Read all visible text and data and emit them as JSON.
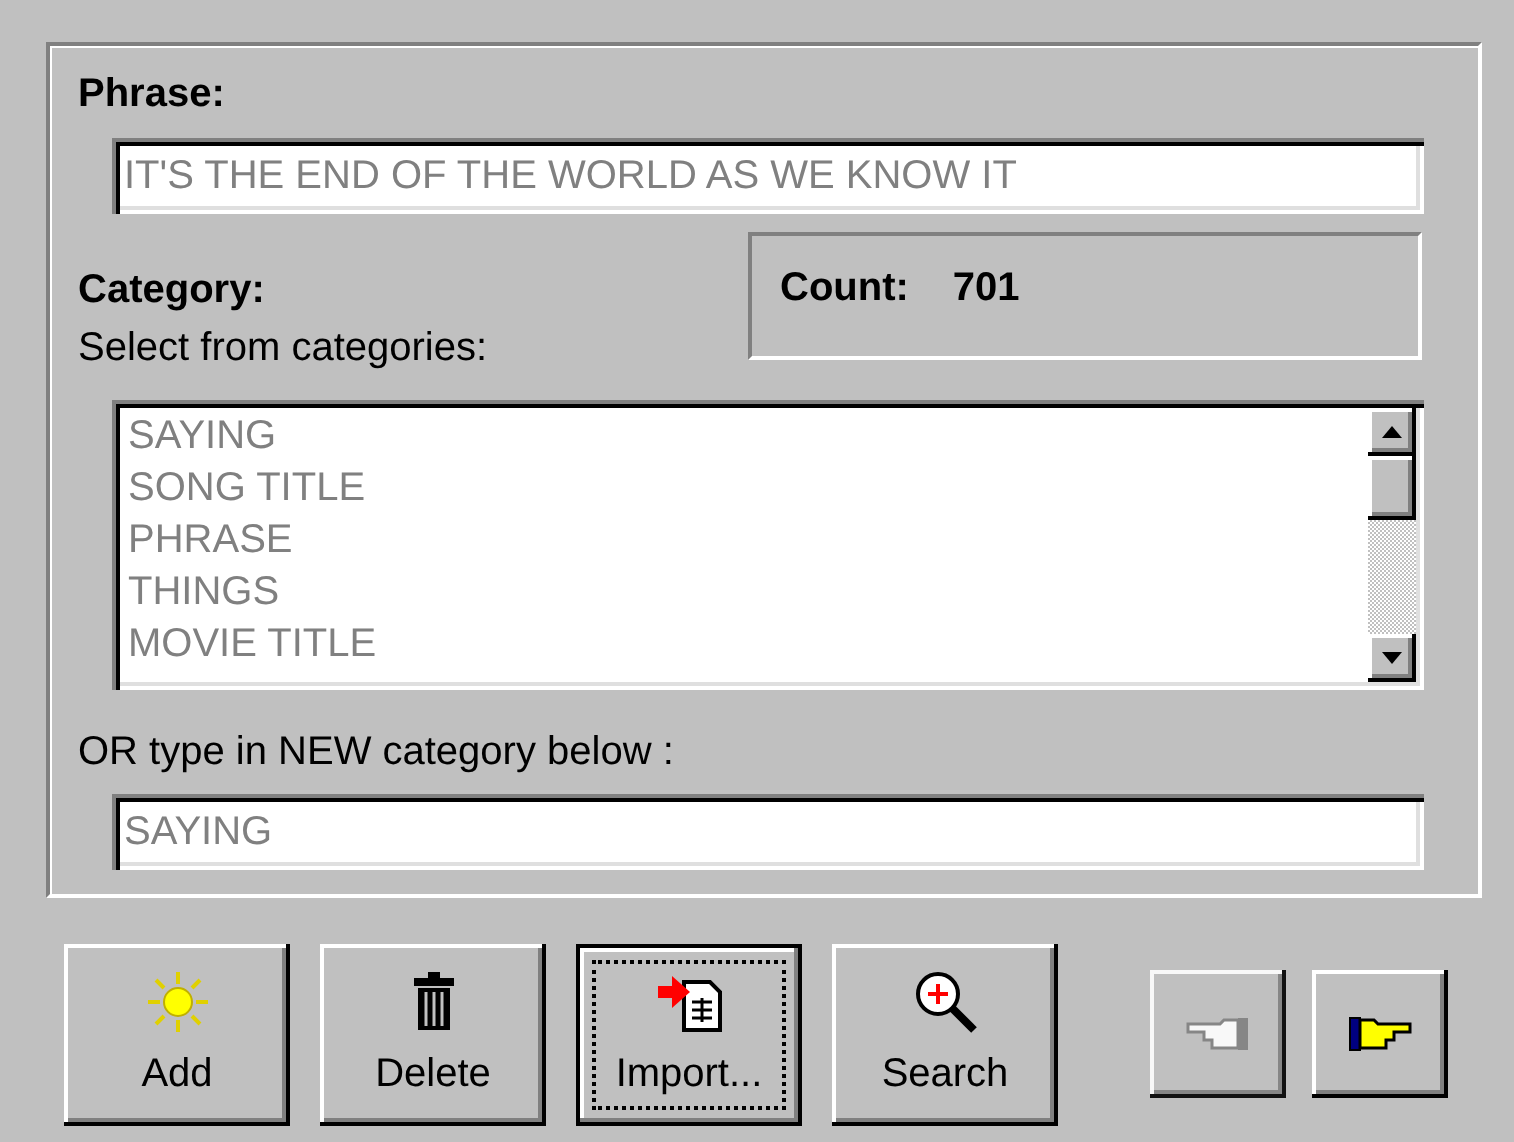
{
  "phrase": {
    "label": "Phrase:",
    "value": "IT'S THE END OF THE WORLD AS WE KNOW IT"
  },
  "count": {
    "label": "Count:",
    "value": "701"
  },
  "category": {
    "label": "Category:",
    "hint": "Select from categories:",
    "items": [
      {
        "text": "SAYING"
      },
      {
        "text": "SONG TITLE"
      },
      {
        "text": "PHRASE"
      },
      {
        "text": "THINGS"
      },
      {
        "text": "MOVIE TITLE"
      }
    ],
    "new_label": "OR type in NEW category below :",
    "new_value": "SAYING"
  },
  "buttons": [
    {
      "kind": "add",
      "label": "Add",
      "focused": false
    },
    {
      "kind": "delete",
      "label": "Delete",
      "focused": false
    },
    {
      "kind": "import",
      "label": "Import...",
      "focused": true
    },
    {
      "kind": "search",
      "label": "Search",
      "focused": false
    }
  ],
  "nav_buttons": [
    {
      "kind": "previous",
      "disabled": true
    },
    {
      "kind": "next",
      "disabled": false
    }
  ]
}
